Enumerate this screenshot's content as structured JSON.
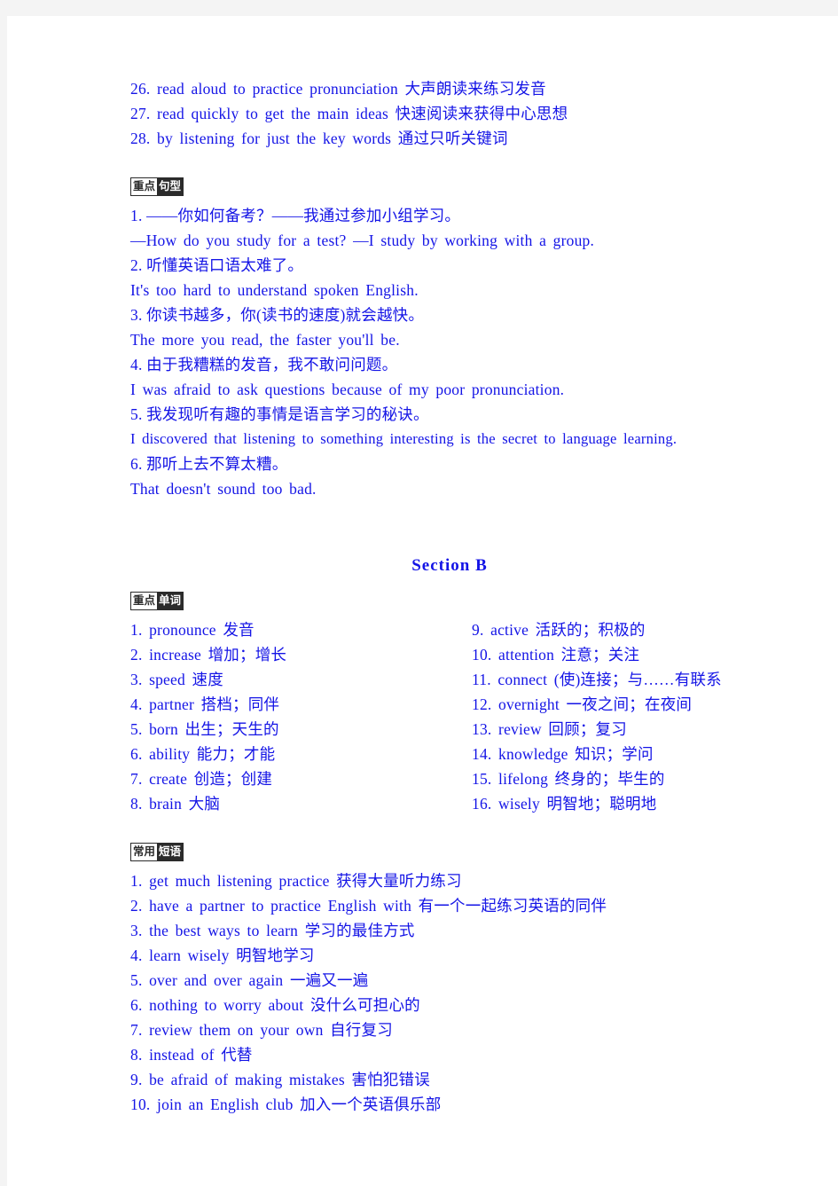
{
  "document": {
    "top_phrases": [
      "26. read aloud to practice pronunciation 大声朗读来练习发音",
      "27. read quickly to get the main ideas 快速阅读来获得中心思想",
      "28. by listening for just the key words 通过只听关键词"
    ],
    "sentence_patterns_badge": {
      "part1": "重点",
      "part2": "句型"
    },
    "sentence_patterns": [
      "1. ——你如何备考？——我通过参加小组学习。",
      "—How do you study for a test? —I study by working with a group.",
      "2. 听懂英语口语太难了。",
      "It's too hard to understand spoken English.",
      "3. 你读书越多，你(读书的速度)就会越快。",
      "The more you read, the faster you'll be.",
      "4. 由于我糟糕的发音，我不敢问问题。",
      "I was afraid to ask questions because of my poor pronunciation.",
      "5. 我发现听有趣的事情是语言学习的秘诀。",
      "I discovered that listening to something interesting is the secret to language learning.",
      "6. 那听上去不算太糟。",
      "That doesn't sound too bad."
    ],
    "section_title": "Section  B",
    "key_words_badge": {
      "part1": "重点",
      "part2": "单词"
    },
    "key_words_left": [
      "1. pronounce  发音",
      "2. increase  增加；增长",
      "3. speed  速度",
      "4. partner  搭档；同伴",
      "5. born  出生；天生的",
      "6. ability  能力；才能",
      "7. create  创造；创建",
      "8. brain  大脑"
    ],
    "key_words_right": [
      "9. active  活跃的；积极的",
      "10. attention  注意；关注",
      "11. connect (使)连接；与……有联系",
      "12. overnight  一夜之间；在夜间",
      "13. review  回顾；复习",
      "14. knowledge  知识；学问",
      "15. lifelong  终身的；毕生的",
      "16. wisely  明智地；聪明地"
    ],
    "common_phrases_badge": {
      "part1": "常用",
      "part2": "短语"
    },
    "common_phrases": [
      "1. get much listening practice 获得大量听力练习",
      "2. have a partner to practice English with 有一个一起练习英语的同伴",
      "3. the best ways to learn 学习的最佳方式",
      "4. learn wisely 明智地学习",
      "5. over and over again 一遍又一遍",
      "6. nothing to worry about 没什么可担心的",
      "7. review them on your own 自行复习",
      "8. instead of 代替",
      "9. be afraid of making mistakes 害怕犯错误",
      "10. join an English club 加入一个英语俱乐部"
    ]
  },
  "colors": {
    "text_blue": "#1414e6",
    "badge_dark": "#2b2b2b",
    "page_background": "#ffffff",
    "outer_background": "#f4f4f4"
  }
}
